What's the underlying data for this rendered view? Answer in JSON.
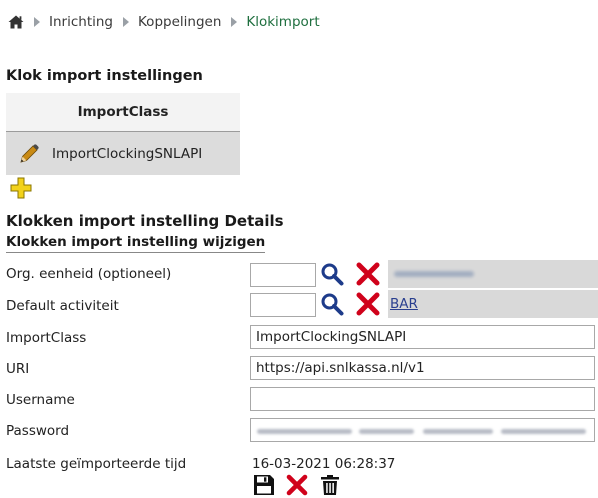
{
  "breadcrumb": {
    "items": [
      "Inrichting",
      "Koppelingen",
      "Klokimport"
    ]
  },
  "settings": {
    "title": "Klok import instellingen",
    "column_header": "ImportClass",
    "rows": [
      "ImportClockingSNLAPI"
    ]
  },
  "details": {
    "title": "Klokken import instelling Details",
    "subtitle": "Klokken import instelling wijzigen",
    "fields": {
      "org_unit": {
        "label": "Org. eenheid (optioneel)",
        "value": ""
      },
      "default_activity": {
        "label": "Default activiteit",
        "value": "",
        "linked": "BAR"
      },
      "import_class": {
        "label": "ImportClass",
        "value": "ImportClockingSNLAPI"
      },
      "uri": {
        "label": "URI",
        "value": "https://api.snlkassa.nl/v1"
      },
      "username": {
        "label": "Username",
        "value": ""
      },
      "password": {
        "label": "Password"
      },
      "last_import": {
        "label": "Laatste geïmporteerde tijd",
        "value": "16-03-2021 06:28:37"
      }
    }
  },
  "colors": {
    "breadcrumb_active": "#1f6f3f",
    "link": "#2a3f8f",
    "delete_red": "#d0021b",
    "add_yellow": "#e5c100"
  },
  "icons": [
    "home-icon",
    "pencil-icon",
    "add-icon",
    "search-icon",
    "delete-icon",
    "save-icon",
    "cancel-icon",
    "trash-icon"
  ]
}
